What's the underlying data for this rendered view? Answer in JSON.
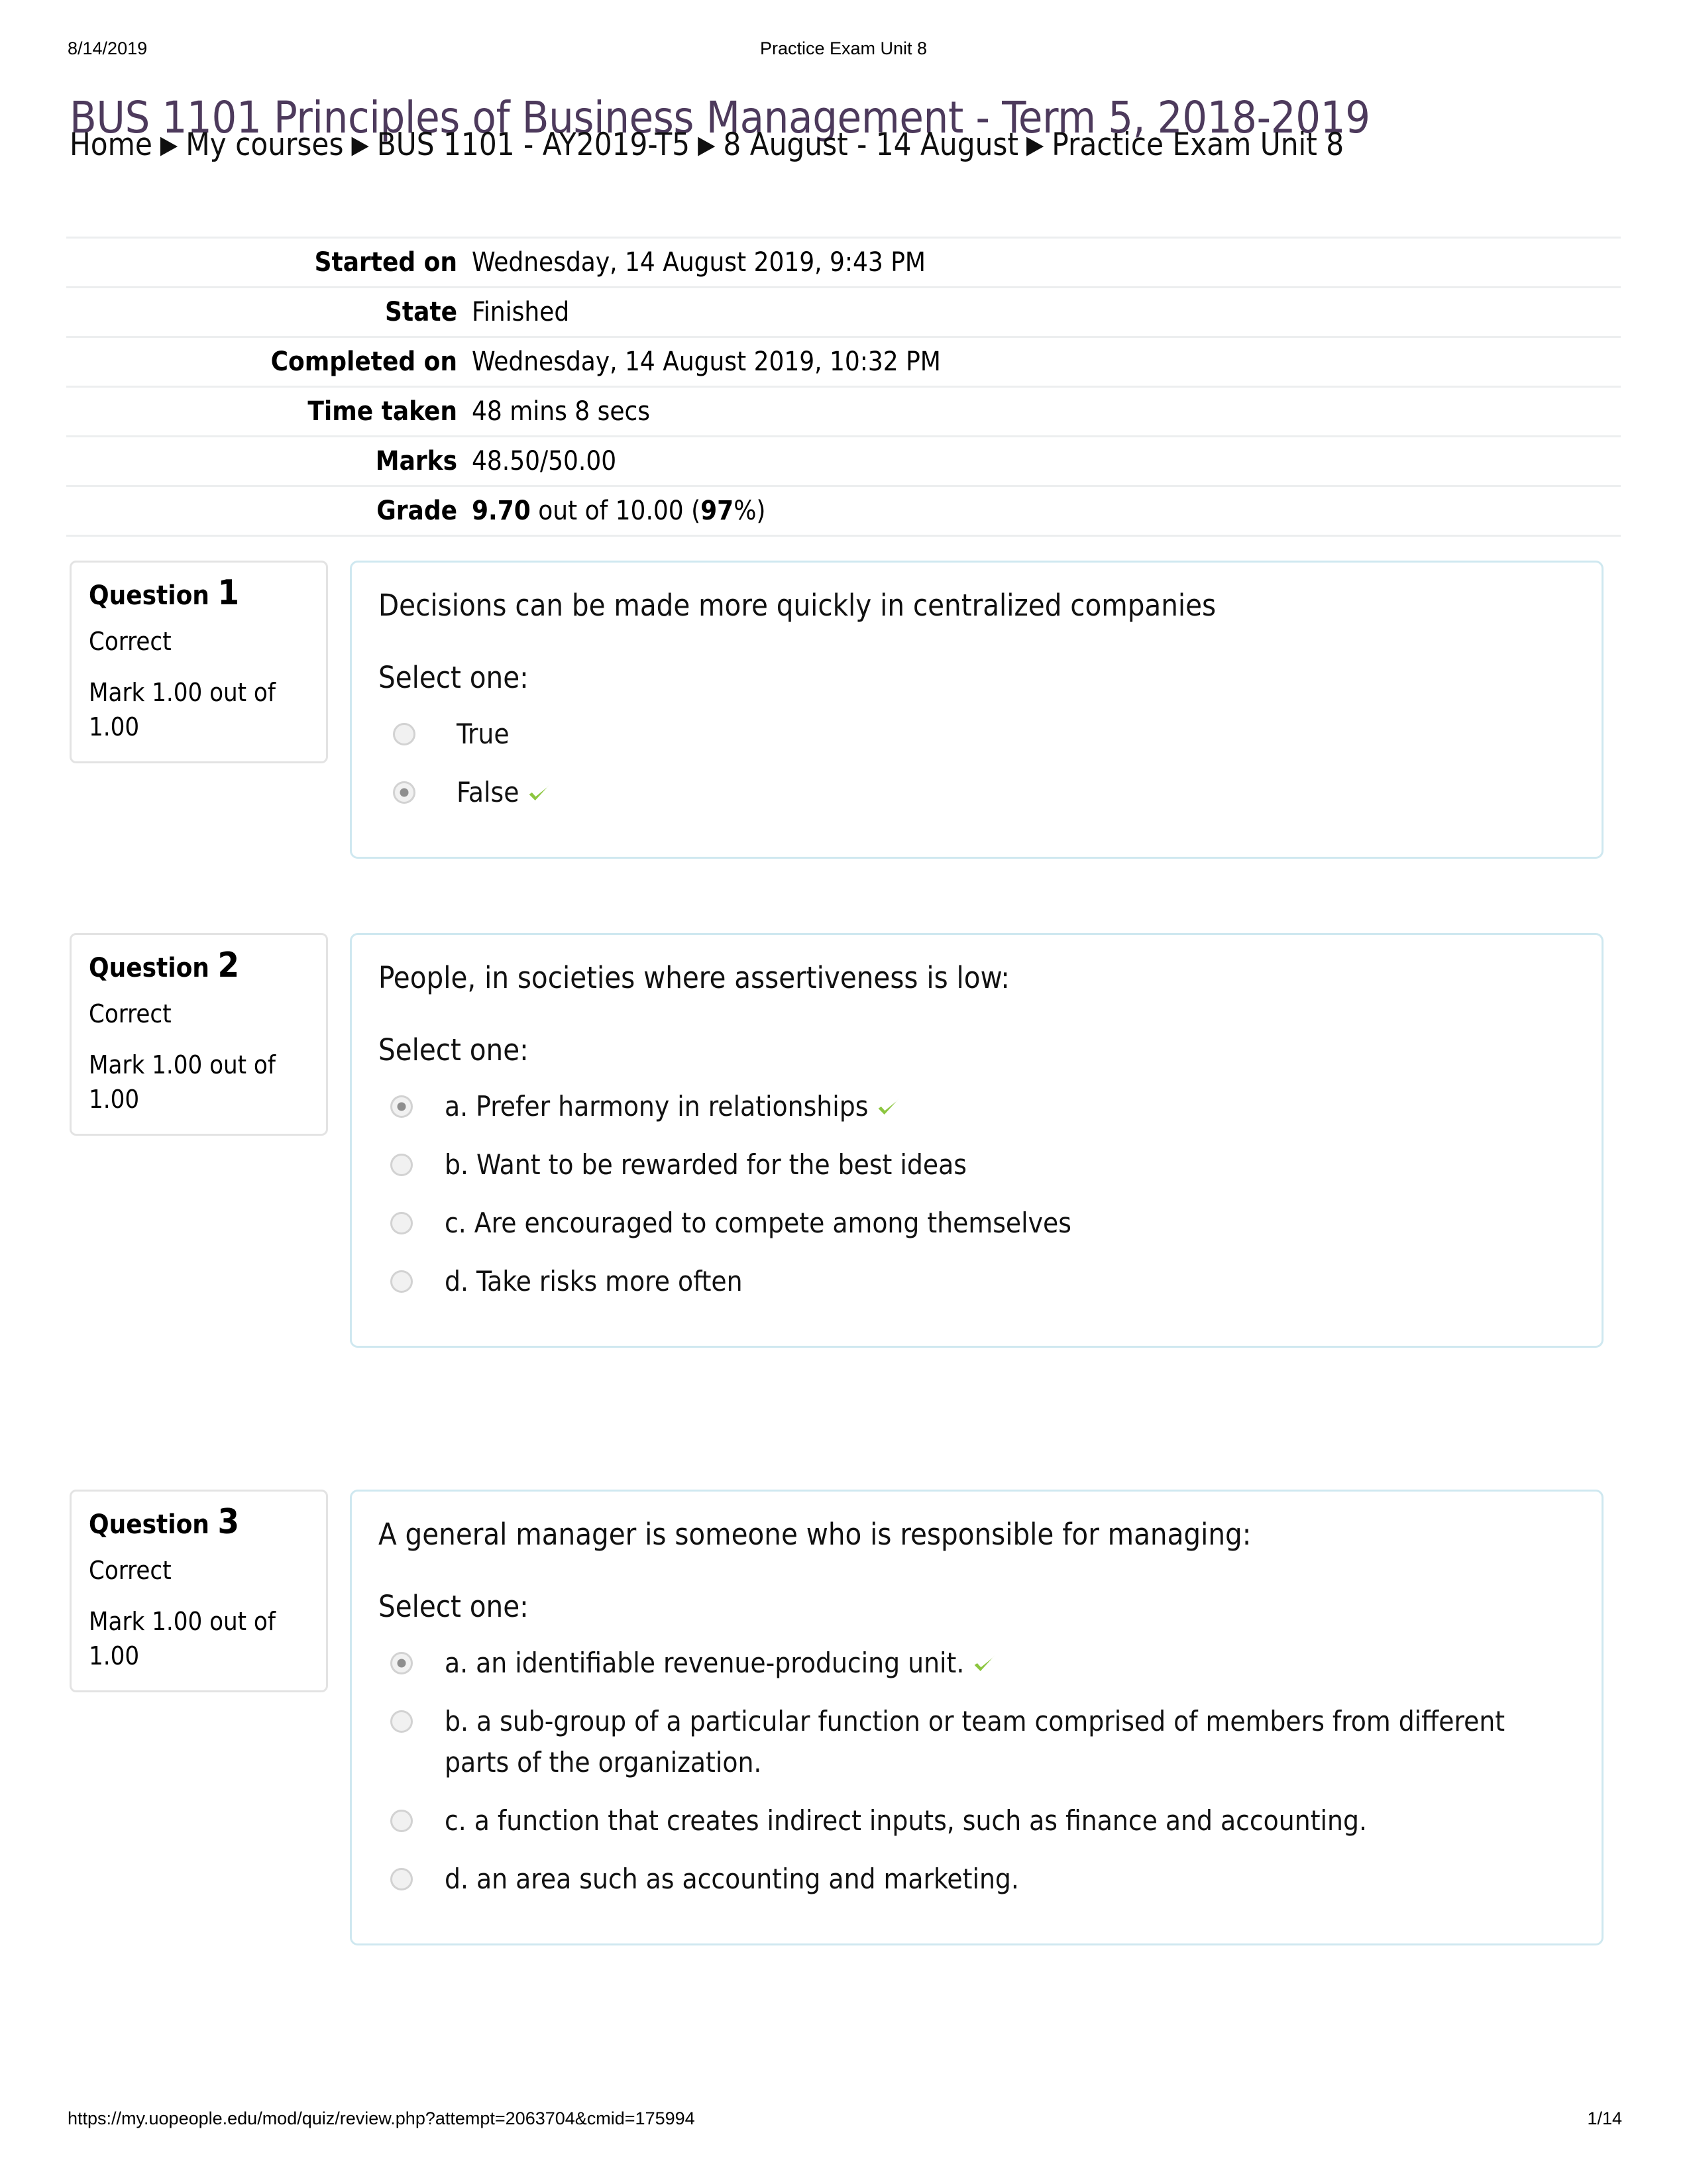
{
  "print_header": {
    "date": "8/14/2019",
    "doc_title": "Practice Exam Unit 8"
  },
  "course_title": "BUS 1101 Principles of Business Management - Term 5, 2018-2019",
  "breadcrumb": {
    "separator": "▶",
    "items": [
      "Home",
      "My courses",
      "BUS 1101 - AY2019-T5",
      "8 August - 14 August",
      "Practice Exam Unit 8"
    ]
  },
  "summary": {
    "rows": [
      {
        "label": "Started on",
        "value": "Wednesday, 14 August 2019, 9:43 PM"
      },
      {
        "label": "State",
        "value": "Finished"
      },
      {
        "label": "Completed on",
        "value": "Wednesday, 14 August 2019, 10:32 PM"
      },
      {
        "label": "Time taken",
        "value": "48 mins 8 secs"
      },
      {
        "label": "Marks",
        "value": "48.50/50.00"
      }
    ],
    "grade_label": "Grade",
    "grade_value_bold": "9.70",
    "grade_value_mid": " out of 10.00 (",
    "grade_percent_bold": "97",
    "grade_value_end": "%)"
  },
  "questions": [
    {
      "number_word": "Question",
      "number": "1",
      "state": "Correct",
      "mark": "Mark 1.00 out of 1.00",
      "text": "Decisions can be made more quickly in centralized companies",
      "prompt": "Select one:",
      "options": [
        {
          "label": "True",
          "selected": false,
          "correct": false
        },
        {
          "label": "False",
          "selected": true,
          "correct": true
        }
      ]
    },
    {
      "number_word": "Question",
      "number": "2",
      "state": "Correct",
      "mark": "Mark 1.00 out of 1.00",
      "text": "People, in societies where assertiveness is low:",
      "prompt": "Select one:",
      "options": [
        {
          "label": "a. Prefer harmony in relationships",
          "selected": true,
          "correct": true
        },
        {
          "label": "b. Want to be rewarded for the best ideas",
          "selected": false,
          "correct": false
        },
        {
          "label": "c. Are encouraged to compete among themselves",
          "selected": false,
          "correct": false
        },
        {
          "label": "d. Take risks more often",
          "selected": false,
          "correct": false
        }
      ]
    },
    {
      "number_word": "Question",
      "number": "3",
      "state": "Correct",
      "mark": "Mark 1.00 out of 1.00",
      "text": "A general manager is someone who is responsible for managing:",
      "prompt": "Select one:",
      "options": [
        {
          "label": "a. an identifiable revenue-producing unit.",
          "selected": true,
          "correct": true
        },
        {
          "label": "b. a sub-group of a particular function or team comprised of members from different parts of the organization.",
          "selected": false,
          "correct": false
        },
        {
          "label": "c. a function that creates indirect inputs, such as finance and accounting.",
          "selected": false,
          "correct": false
        },
        {
          "label": "d. an area such as accounting and marketing.",
          "selected": false,
          "correct": false
        }
      ]
    }
  ],
  "footer": {
    "url": "https://my.uopeople.edu/mod/quiz/review.php?attempt=2063704&cmid=175994",
    "page": "1/14"
  },
  "colors": {
    "title": "#4d3a5c",
    "content_border": "#cfe8f0",
    "info_border": "#e3e3e3",
    "tick_green": "#8cc63f",
    "rule": "#eceeef"
  }
}
